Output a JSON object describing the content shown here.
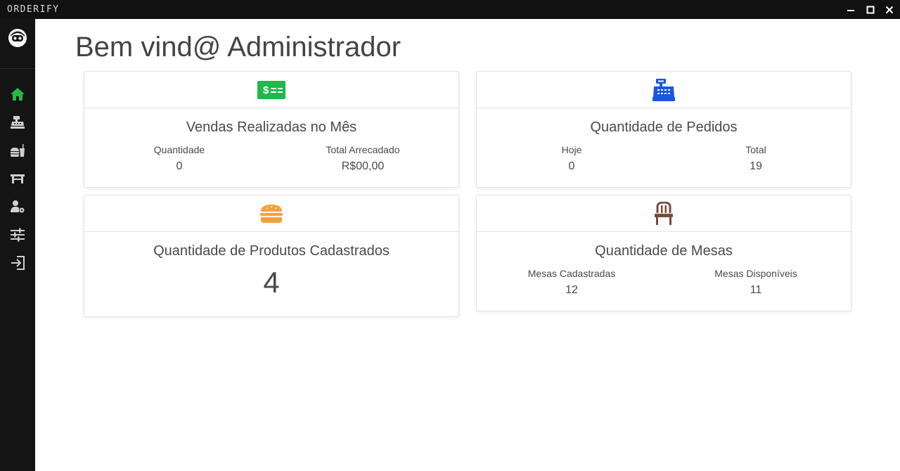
{
  "window": {
    "title": "ORDERIFY"
  },
  "sidebar": {
    "items": [
      {
        "icon": "home-icon",
        "color": "#28b84a"
      },
      {
        "icon": "cash-register-icon",
        "color": "#cfcfcf"
      },
      {
        "icon": "food-drink-icon",
        "color": "#cfcfcf"
      },
      {
        "icon": "table-icon",
        "color": "#cfcfcf"
      },
      {
        "icon": "user-settings-icon",
        "color": "#cfcfcf"
      },
      {
        "icon": "sliders-icon",
        "color": "#cfcfcf"
      },
      {
        "icon": "logout-icon",
        "color": "#cfcfcf"
      }
    ]
  },
  "main": {
    "title": "Bem vind@ Administrador",
    "cards": {
      "sales": {
        "icon": "money-bill-icon",
        "icon_color": "#1fb84a",
        "title": "Vendas Realizadas no Mês",
        "stats": [
          {
            "label": "Quantidade",
            "value": "0"
          },
          {
            "label": "Total Arrecadado",
            "value": "R$00,00"
          }
        ]
      },
      "orders": {
        "icon": "cash-register-icon",
        "icon_color": "#1a56e0",
        "title": "Quantidade de Pedidos",
        "stats": [
          {
            "label": "Hoje",
            "value": "0"
          },
          {
            "label": "Total",
            "value": "19"
          }
        ]
      },
      "products": {
        "icon": "burger-icon",
        "icon_color": "#f5a13a",
        "title": "Quantidade de Produtos Cadastrados",
        "value": "4"
      },
      "tables": {
        "icon": "chair-icon",
        "icon_color": "#7a4a3a",
        "title": "Quantidade de Mesas",
        "stats": [
          {
            "label": "Mesas Cadastradas",
            "value": "12"
          },
          {
            "label": "Mesas Disponíveis",
            "value": "11"
          }
        ]
      }
    }
  }
}
